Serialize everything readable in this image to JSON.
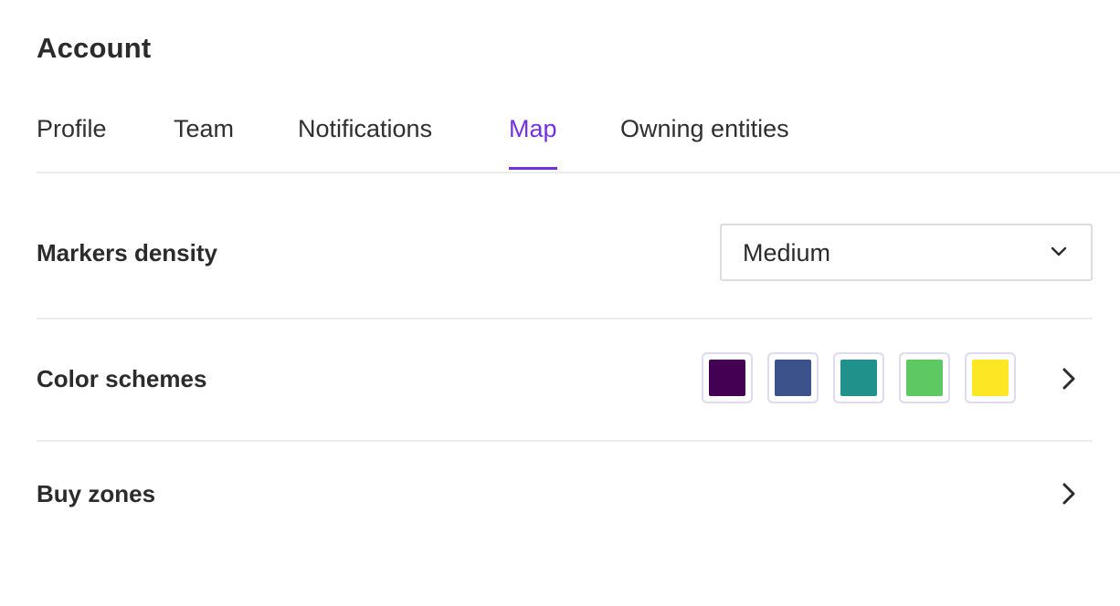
{
  "header": {
    "title": "Account"
  },
  "tabs": [
    {
      "label": "Profile",
      "active": false
    },
    {
      "label": "Team",
      "active": false
    },
    {
      "label": "Notifications",
      "active": false
    },
    {
      "label": "Map",
      "active": true
    },
    {
      "label": "Owning entities",
      "active": false
    }
  ],
  "colors": {
    "accent": "#7431e0",
    "divider": "#ececee"
  },
  "settings": {
    "markers_density": {
      "label": "Markers density",
      "selected": "Medium",
      "icon": "chevron-down-icon"
    },
    "color_schemes": {
      "label": "Color schemes",
      "swatches": [
        "#440154",
        "#3b528b",
        "#21918c",
        "#5ec962",
        "#fde725"
      ],
      "icon": "chevron-right-icon"
    },
    "buy_zones": {
      "label": "Buy zones",
      "icon": "chevron-right-icon"
    }
  }
}
